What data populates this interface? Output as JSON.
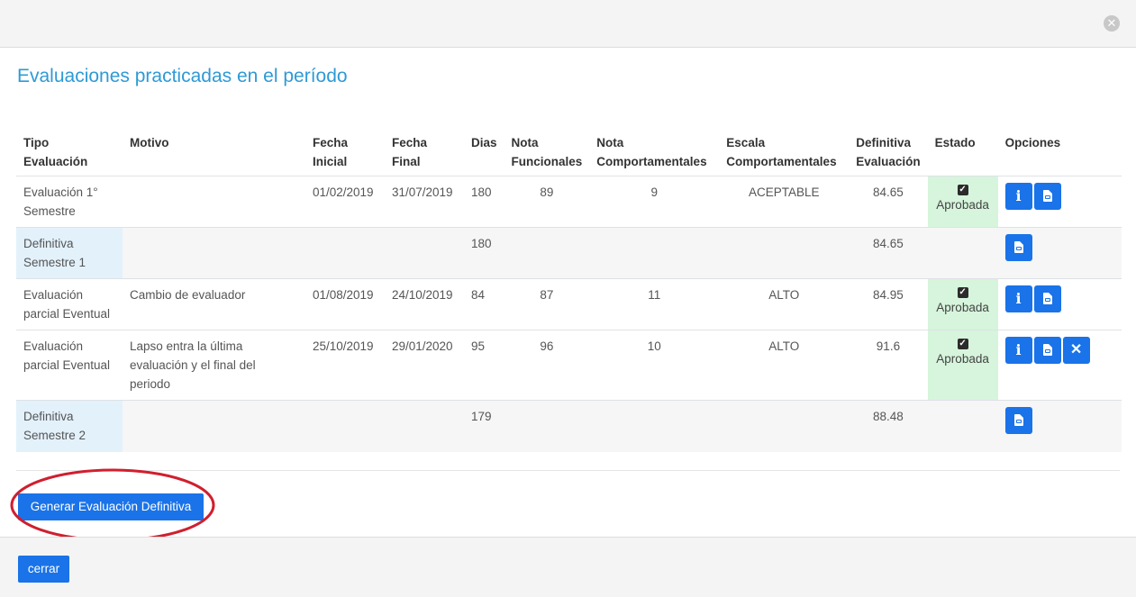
{
  "modal": {
    "title": "Evaluaciones practicadas en el período",
    "close_icon": "close-icon"
  },
  "table": {
    "headers": {
      "tipo": "Tipo Evaluación",
      "motivo": "Motivo",
      "fecha_inicial": "Fecha Inicial",
      "fecha_final": "Fecha Final",
      "dias": "Dias",
      "nota_funcionales": "Nota Funcionales",
      "nota_comportamentales": "Nota Comportamentales",
      "escala_comportamentales": "Escala Comportamentales",
      "definitiva": "Definitiva Evaluación",
      "estado": "Estado",
      "opciones": "Opciones"
    },
    "rows": [
      {
        "tipo": "Evaluación 1° Semestre",
        "motivo": "",
        "fecha_inicial": "01/02/2019",
        "fecha_final": "31/07/2019",
        "dias": "180",
        "nota_funcionales": "89",
        "nota_comportamentales": "9",
        "escala": "ACEPTABLE",
        "definitiva": "84.65",
        "estado": "Aprobada"
      },
      {
        "tipo": "Definitiva Semestre 1",
        "motivo": "",
        "fecha_inicial": "",
        "fecha_final": "",
        "dias": "180",
        "nota_funcionales": "",
        "nota_comportamentales": "",
        "escala": "",
        "definitiva": "84.65",
        "estado": ""
      },
      {
        "tipo": "Evaluación parcial Eventual",
        "motivo": "Cambio de evaluador",
        "fecha_inicial": "01/08/2019",
        "fecha_final": "24/10/2019",
        "dias": "84",
        "nota_funcionales": "87",
        "nota_comportamentales": "11",
        "escala": "ALTO",
        "definitiva": "84.95",
        "estado": "Aprobada"
      },
      {
        "tipo": "Evaluación parcial Eventual",
        "motivo": "Lapso entra la última evaluación y el final del periodo",
        "fecha_inicial": "25/10/2019",
        "fecha_final": "29/01/2020",
        "dias": "95",
        "nota_funcionales": "96",
        "nota_comportamentales": "10",
        "escala": "ALTO",
        "definitiva": "91.6",
        "estado": "Aprobada"
      },
      {
        "tipo": "Definitiva Semestre 2",
        "motivo": "",
        "fecha_inicial": "",
        "fecha_final": "",
        "dias": "179",
        "nota_funcionales": "",
        "nota_comportamentales": "",
        "escala": "",
        "definitiva": "88.48",
        "estado": ""
      }
    ]
  },
  "actions": {
    "generate_label": "Generar Evaluación Definitiva",
    "close_label": "cerrar"
  },
  "colors": {
    "title": "#2e9ad6",
    "primary_button": "#1a73e8",
    "approved_bg": "#d6f5dc",
    "definitiva_bg": "#e3f1fb",
    "annotation_circle": "#d01f2e"
  }
}
